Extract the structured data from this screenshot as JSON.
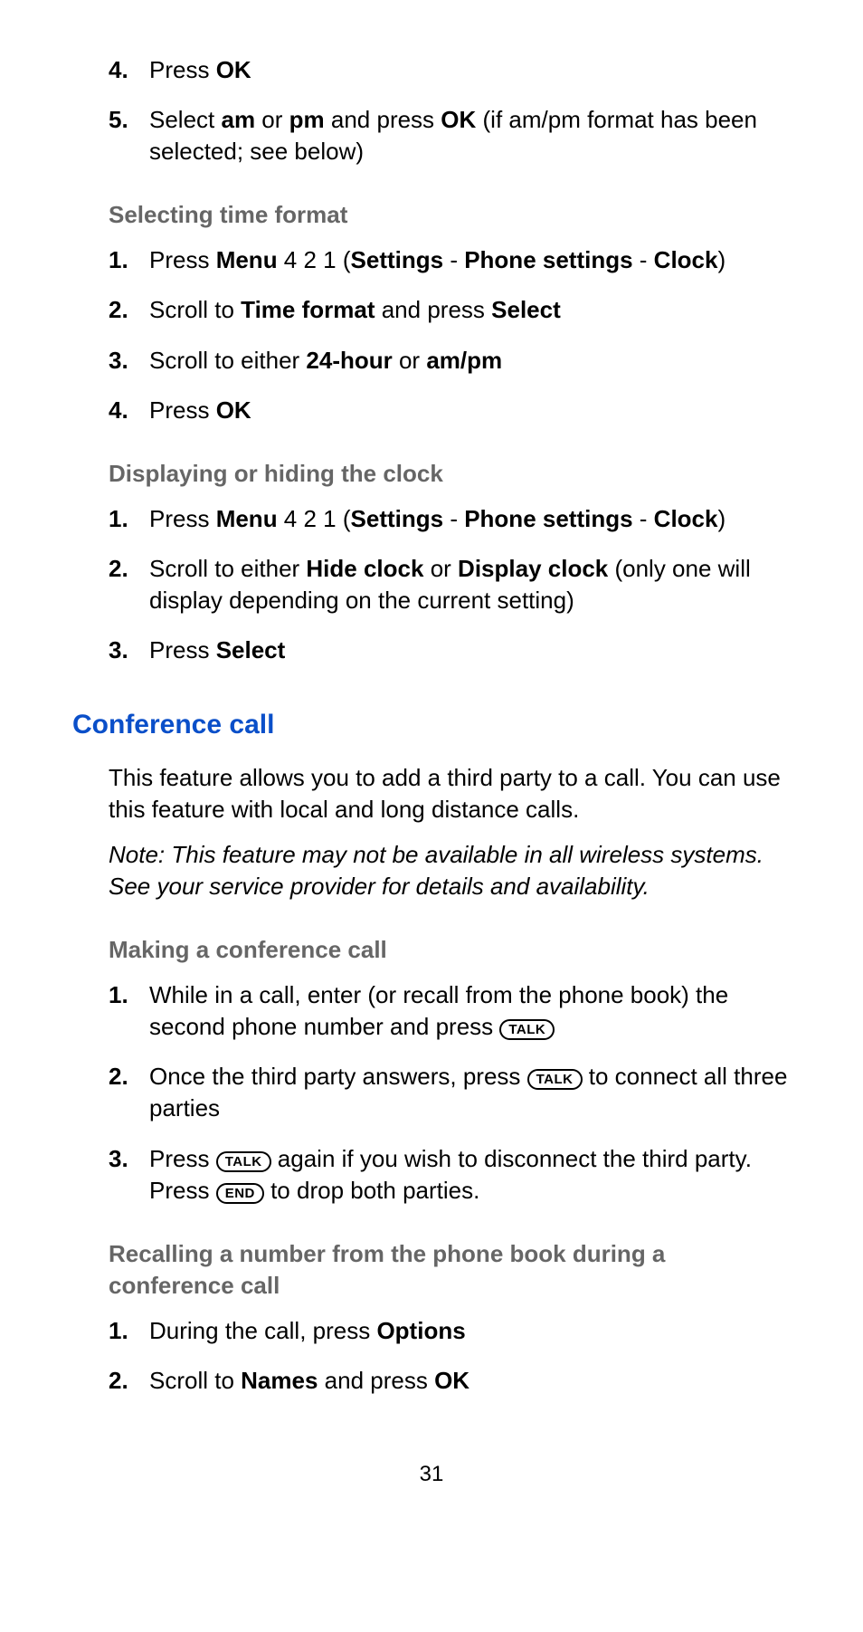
{
  "top": {
    "s4": {
      "pre": "Press ",
      "b1": "OK"
    },
    "s5": {
      "pre": "Select ",
      "b1": "am",
      "mid1": " or ",
      "b2": "pm",
      "mid2": " and press ",
      "b3": "OK",
      "tail": " (if am/pm format has been selected; see below)"
    }
  },
  "sec1": {
    "head": "Selecting time format",
    "s1": {
      "pre": "Press ",
      "b1": "Menu",
      "mid1": " 4 2 1 (",
      "b2": "Settings",
      "mid2": " - ",
      "b3": "Phone settings",
      "mid3": " - ",
      "b4": "Clock",
      "tail": ")"
    },
    "s2": {
      "pre": "Scroll to ",
      "b1": "Time format",
      "mid1": " and press ",
      "b2": "Select"
    },
    "s3": {
      "pre": "Scroll to either ",
      "b1": "24-hour",
      "mid1": " or ",
      "b2": "am/pm"
    },
    "s4": {
      "pre": "Press ",
      "b1": "OK"
    }
  },
  "sec2": {
    "head": "Displaying or hiding the clock",
    "s1": {
      "pre": "Press ",
      "b1": "Menu",
      "mid1": " 4 2 1 (",
      "b2": "Settings",
      "mid2": " - ",
      "b3": "Phone settings",
      "mid3": " - ",
      "b4": "Clock",
      "tail": ")"
    },
    "s2": {
      "pre": "Scroll to either ",
      "b1": "Hide clock",
      "mid1": " or ",
      "b2": "Display clock",
      "tail": " (only one will display depending on the current setting)"
    },
    "s3": {
      "pre": "Press ",
      "b1": "Select"
    }
  },
  "conf": {
    "head": "Conference call",
    "para": "This feature allows you to add a third party to a call. You can use this feature with local and long distance calls.",
    "note": "Note: This feature may not be available in all wireless systems. See your service provider for details and availability."
  },
  "sec3": {
    "head": "Making a conference call",
    "s1": {
      "pre": "While in a call, enter (or recall from the phone book) the second phone number and press ",
      "k1": "TALK"
    },
    "s2": {
      "pre": "Once the third party answers, press ",
      "k1": "TALK",
      "tail": " to connect all three parties"
    },
    "s3": {
      "pre": "Press ",
      "k1": "TALK",
      "mid1": " again if you wish to disconnect the third party. Press ",
      "k2": "END",
      "tail": " to drop both parties."
    }
  },
  "sec4": {
    "head": "Recalling a number from the phone book during a conference call",
    "s1": {
      "pre": "During the call, press ",
      "b1": "Options"
    },
    "s2": {
      "pre": "Scroll to ",
      "b1": "Names",
      "mid1": " and press ",
      "b2": "OK"
    }
  },
  "pagenum": "31"
}
